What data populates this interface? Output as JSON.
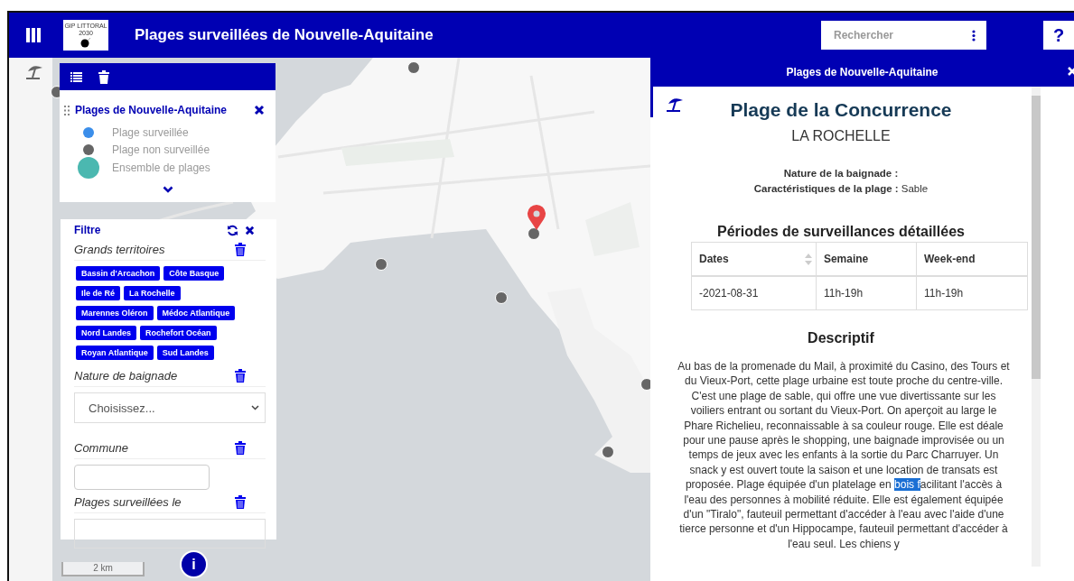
{
  "header": {
    "logo_text": [
      "GIP LITTORAL",
      "2030"
    ],
    "title": "Plages surveillées de Nouvelle-Aquitaine",
    "search": {
      "placeholder": "Rechercher"
    },
    "help": "?"
  },
  "legend": {
    "layer_title": "Plages de Nouvelle-Aquitaine",
    "items": [
      {
        "label": "Plage surveillée",
        "color": "#3b8eea",
        "kind": "small"
      },
      {
        "label": "Plage non surveillée",
        "color": "#666666",
        "kind": "small"
      },
      {
        "label": "Ensemble de plages",
        "color": "#4bb8b0",
        "kind": "large"
      }
    ]
  },
  "filter": {
    "title": "Filtre",
    "sections": [
      {
        "kind": "tags",
        "label": "Grands territoires",
        "tags": [
          "Bassin d'Arcachon",
          "Côte Basque",
          "Ile de Ré",
          "La Rochelle",
          "Marennes Oléron",
          "Médoc Atlantique",
          "Nord Landes",
          "Rochefort Océan",
          "Royan Atlantique",
          "Sud Landes"
        ]
      },
      {
        "kind": "select",
        "label": "Nature de baignade",
        "placeholder": "Choisissez..."
      },
      {
        "kind": "input",
        "label": "Commune"
      },
      {
        "kind": "date",
        "label": "Plages surveillées le"
      }
    ]
  },
  "map": {
    "scale": "2 km",
    "info": "i"
  },
  "detail": {
    "panel_title": "Plages de Nouvelle-Aquitaine",
    "beach_name": "Plage de la Concurrence",
    "commune": "LA ROCHELLE",
    "fields": [
      {
        "label": "Nature de la baignade :"
      },
      {
        "label": "Caractéristiques de la plage :",
        "value": "Sable"
      }
    ],
    "table_title": "Périodes de surveillances détaillées",
    "table": {
      "columns": [
        {
          "label": "Dates",
          "sortable": true
        },
        {
          "label": "Semaine",
          "sortable": false
        },
        {
          "label": "Week-end",
          "sortable": false
        }
      ],
      "rows": [
        [
          "-2021-08-31",
          "11h-19h",
          "11h-19h"
        ]
      ]
    },
    "description_title": "Descriptif",
    "description": [
      {
        "text": "Au bas de la promenade du Mail, à proximité du Casino, des Tours et du Vieux-Port, cette plage urbaine est toute proche du centre-ville. C'est une plage de sable, qui offre une vue divertissante sur les voiliers entrant ou sortant du Vieux-Port. On aperçoit au large le Phare Richelieu, reconnaissable à sa couleur rouge. Elle est déale pour une pause après le shopping, une baignade improvisée ou un temps de jeux avec les enfants à la sortie du Parc Charruyer. Un snack y est ouvert toute la saison et une location de transats est proposée. Plage équipée d'un platelage en ",
        "selected": false
      },
      {
        "text": "bois f",
        "selected": true
      },
      {
        "text": "acilitant l'accès à l'eau des personnes à mobilité réduite. Elle est également équipée d'un \"Tiralo\", fauteuil permettant d'accéder à l'eau avec l'aide d'une tierce personne et d'un Hippocampe, fauteuil permettant d'accéder à l'eau seul. Les chiens y",
        "selected": false
      }
    ]
  }
}
